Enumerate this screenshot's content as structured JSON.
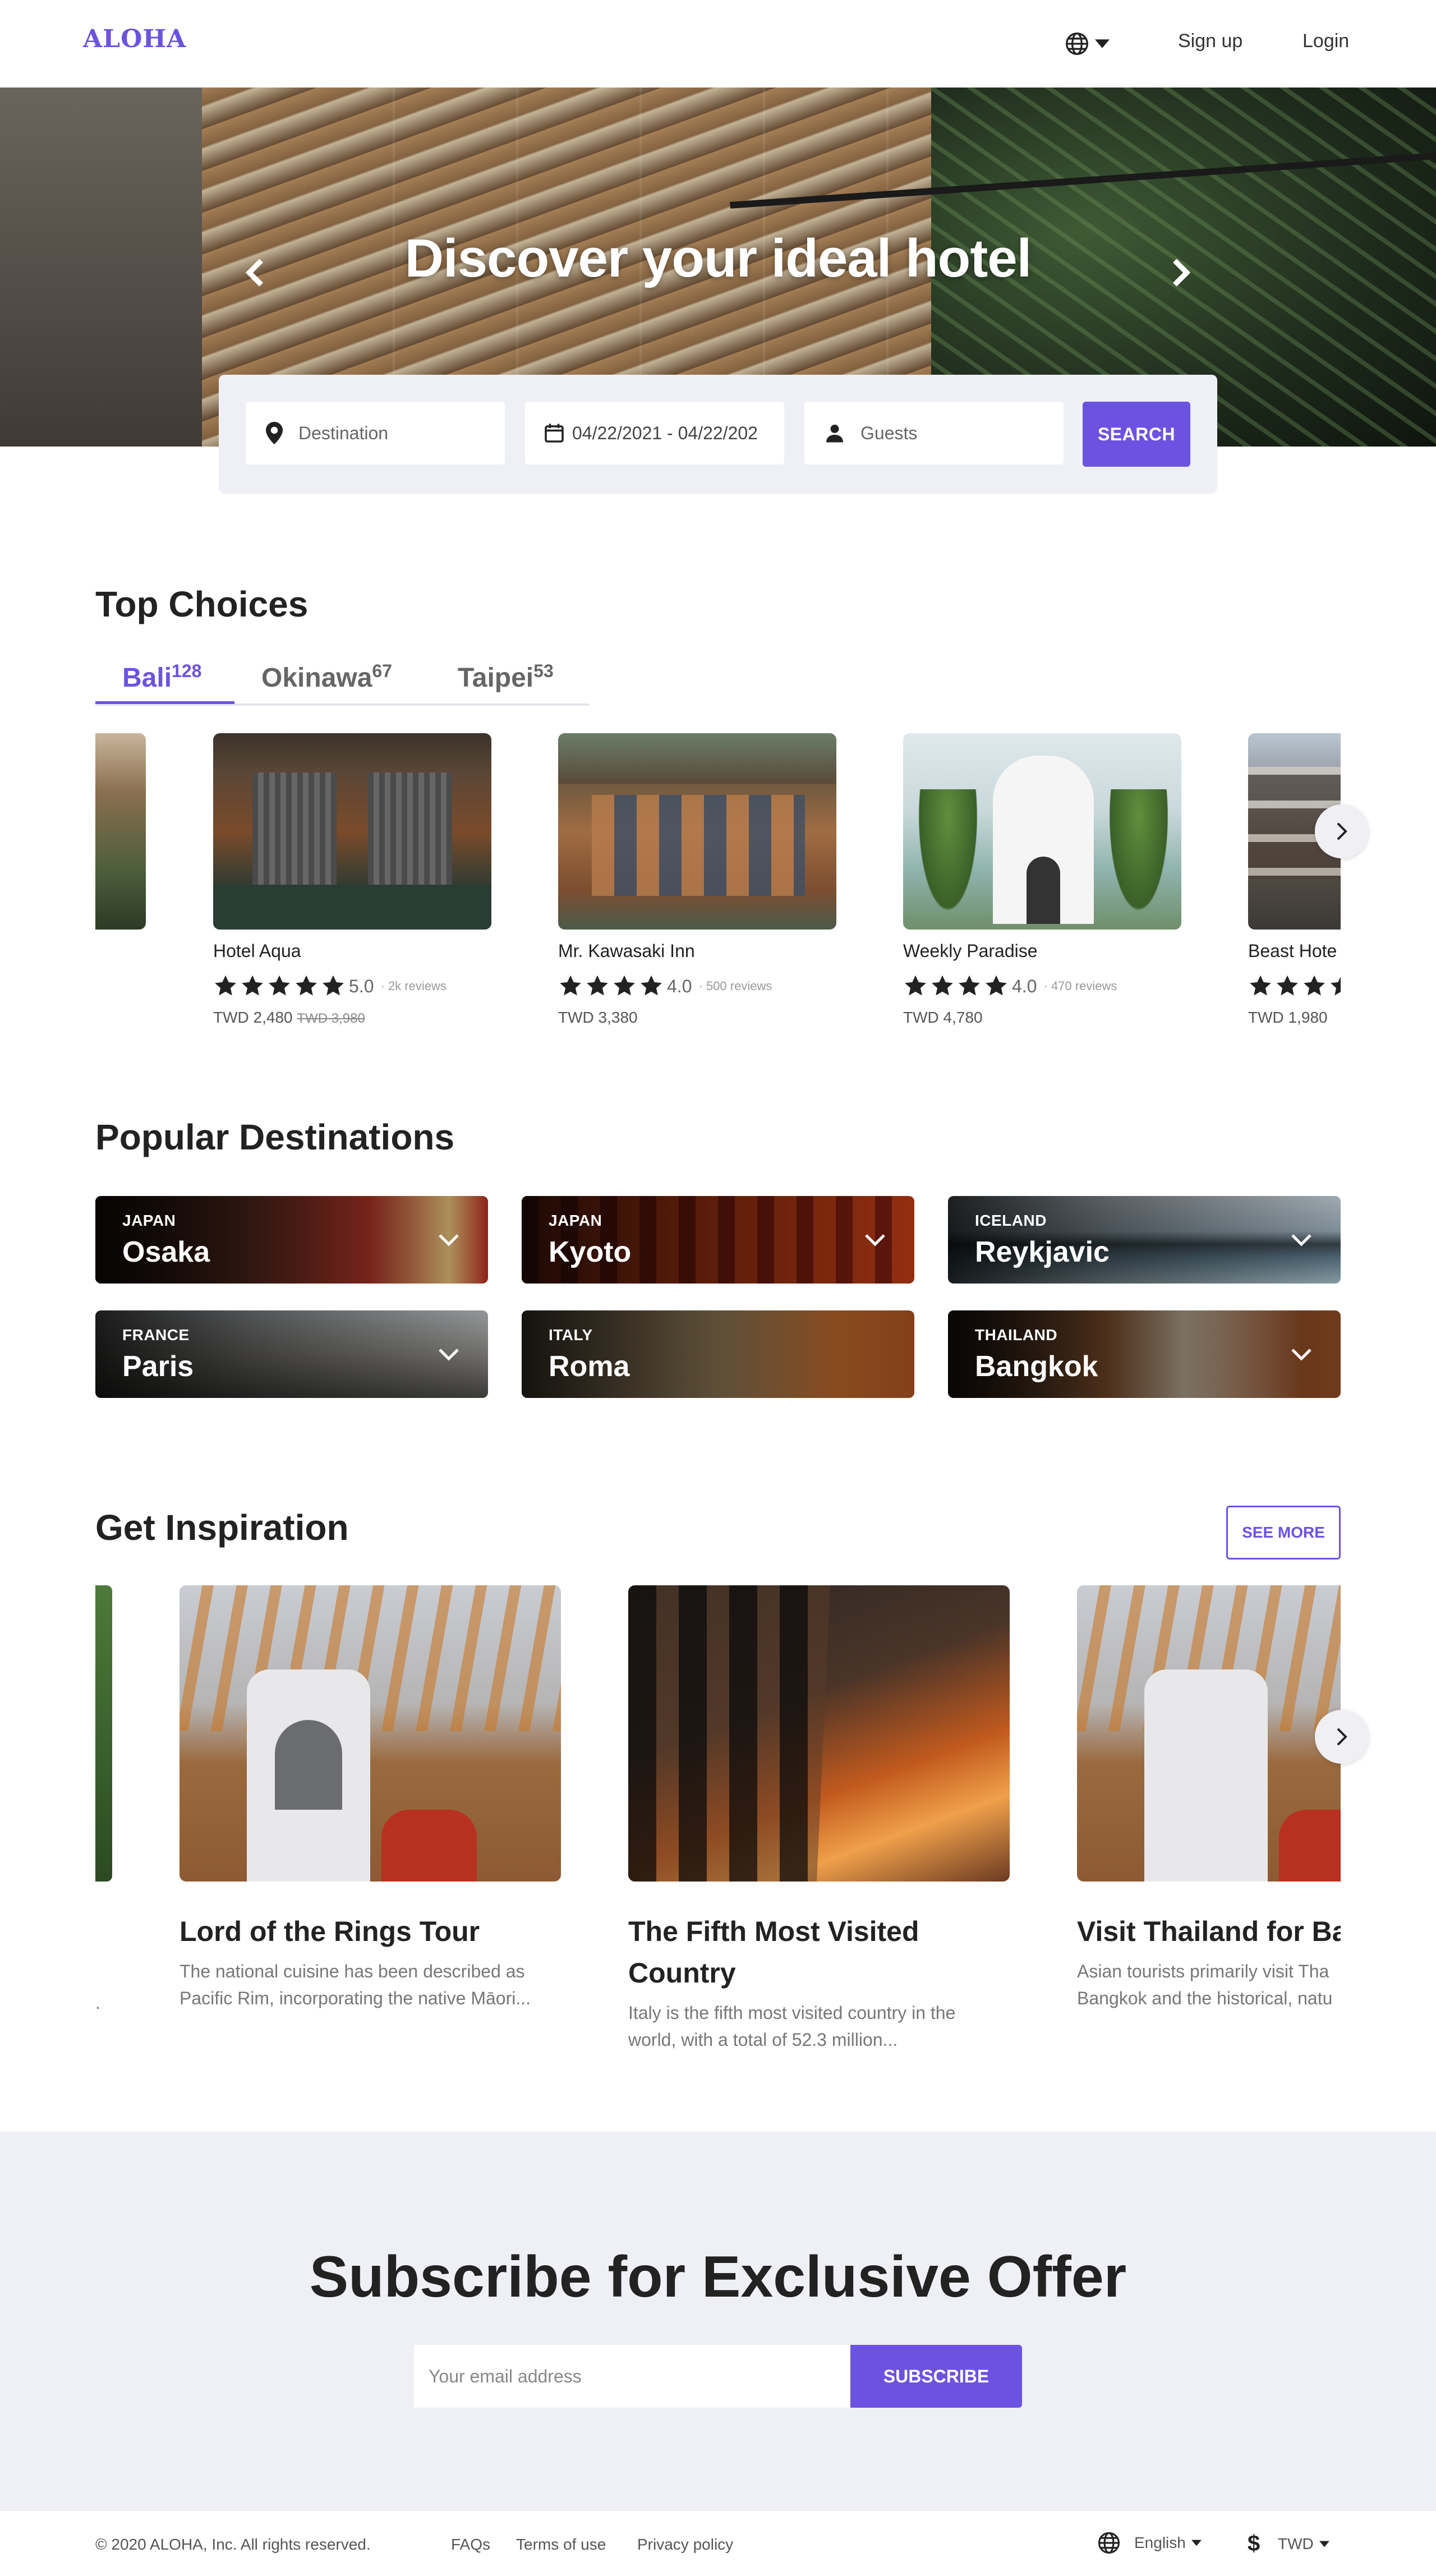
{
  "nav": {
    "logo": "ALOHA",
    "signup": "Sign up",
    "login": "Login"
  },
  "hero": {
    "title": "Discover your ideal hotel"
  },
  "search": {
    "destination_placeholder": "Destination",
    "date_value": "04/22/2021 - 04/22/202",
    "guests_placeholder": "Guests",
    "button": "SEARCH"
  },
  "top_choices": {
    "title": "Top Choices",
    "tabs": [
      {
        "label": "Bali",
        "count": "128"
      },
      {
        "label": "Okinawa",
        "count": "67"
      },
      {
        "label": "Taipei",
        "count": "53"
      }
    ],
    "hotels": [
      {
        "name": "Hotel Aqua",
        "rating": "5.0",
        "stars": 5,
        "reviews": "2k reviews",
        "price": "TWD 2,480",
        "old_price": "TWD 3,980"
      },
      {
        "name": "Mr. Kawasaki Inn",
        "rating": "4.0",
        "stars": 4,
        "reviews": "500 reviews",
        "price": "TWD 3,380",
        "old_price": ""
      },
      {
        "name": "Weekly Paradise",
        "rating": "4.0",
        "stars": 4,
        "reviews": "470 reviews",
        "price": "TWD 4,780",
        "old_price": ""
      },
      {
        "name": "Beast Hote",
        "rating": "",
        "stars": 3.5,
        "reviews": "",
        "price": "TWD 1,980",
        "old_price": ""
      }
    ]
  },
  "destinations": {
    "title": "Popular Destinations",
    "items": [
      {
        "country": "JAPAN",
        "city": "Osaka"
      },
      {
        "country": "JAPAN",
        "city": "Kyoto"
      },
      {
        "country": "ICELAND",
        "city": "Reykjavic"
      },
      {
        "country": "FRANCE",
        "city": "Paris"
      },
      {
        "country": "ITALY",
        "city": "Roma"
      },
      {
        "country": "THAILAND",
        "city": "Bangkok"
      }
    ]
  },
  "inspiration": {
    "title": "Get Inspiration",
    "see_more": "SEE MORE",
    "partial_left_text": ".",
    "articles": [
      {
        "title_1": "Lord of the Rings Tour",
        "title_2": "",
        "text_1": "The national cuisine has been described as",
        "text_2": "Pacific Rim, incorporating the native Māori..."
      },
      {
        "title_1": "The Fifth Most Visited",
        "title_2": "Country",
        "text_1": "Italy is the fifth most visited country in the",
        "text_2": "world, with a total of 52.3 million..."
      },
      {
        "title_1": "Visit Thailand for Ba",
        "title_2": "",
        "text_1": "Asian tourists primarily visit Tha",
        "text_2": "Bangkok and the historical, natu"
      }
    ]
  },
  "subscribe": {
    "title": "Subscribe for Exclusive Offer",
    "placeholder": "Your email address",
    "button": "SUBSCRIBE"
  },
  "footer": {
    "copyright": "© 2020 ALOHA, Inc. All rights reserved.",
    "faqs": "FAQs",
    "terms": "Terms of use",
    "privacy": "Privacy policy",
    "language": "English",
    "currency": "TWD"
  },
  "colors": {
    "accent": "#6c52e0",
    "panel": "#efeff6"
  }
}
